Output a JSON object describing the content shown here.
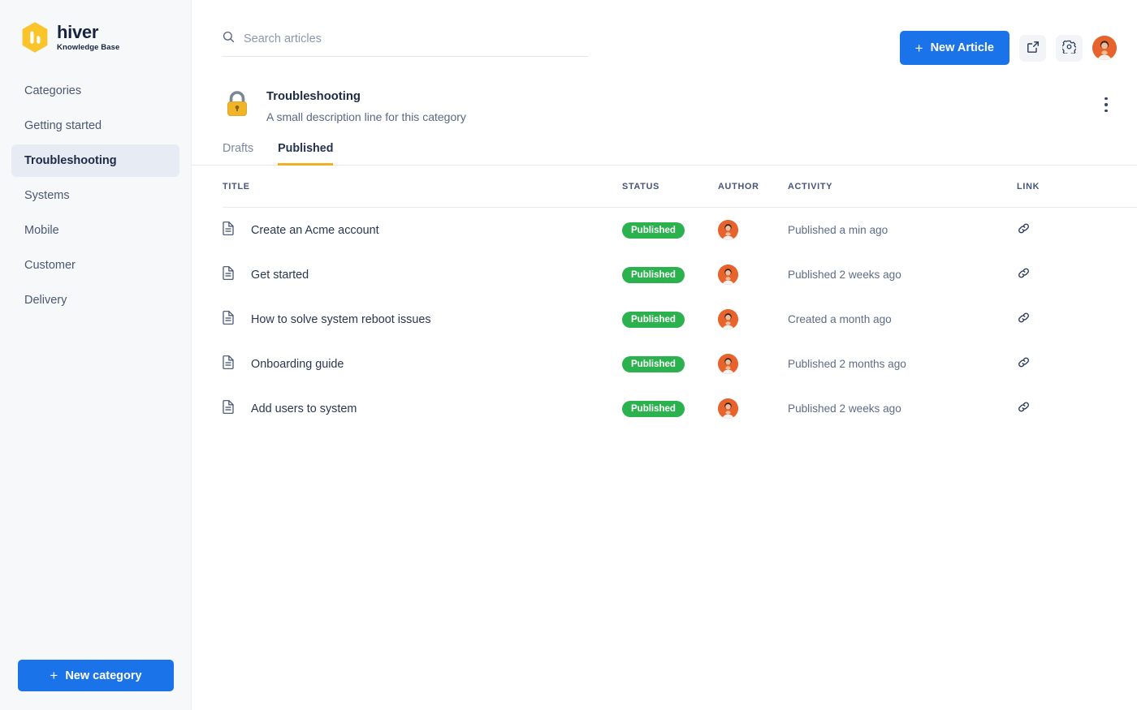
{
  "brand": {
    "name": "hiver",
    "subtitle": "Knowledge Base",
    "logo_icon": "hexagon-h-logo",
    "accent_yellow": "#fbc42b",
    "accent_blue": "#1a73e8"
  },
  "sidebar": {
    "items": [
      {
        "label": "Categories",
        "active": false
      },
      {
        "label": "Getting started",
        "active": false
      },
      {
        "label": "Troubleshooting",
        "active": true
      },
      {
        "label": "Systems",
        "active": false
      },
      {
        "label": "Mobile",
        "active": false
      },
      {
        "label": "Customer",
        "active": false
      },
      {
        "label": "Delivery",
        "active": false
      }
    ],
    "new_category_button": {
      "label": "New category",
      "icon": "plus-icon"
    }
  },
  "topbar": {
    "search": {
      "placeholder": "Search articles",
      "value": "",
      "icon": "search-icon"
    },
    "new_article_button": {
      "label": "New Article",
      "icon": "plus-icon"
    },
    "external_link_icon": "external-link-icon",
    "settings_icon": "gear-icon",
    "profile_avatar": "user-avatar"
  },
  "category": {
    "icon": "lock-icon",
    "title": "Troubleshooting",
    "description": "A small description line for this category",
    "menu_icon": "kebab-menu-icon"
  },
  "tabs": [
    {
      "label": "Drafts",
      "active": false
    },
    {
      "label": "Published",
      "active": true
    }
  ],
  "table": {
    "columns": [
      "TITLE",
      "STATUS",
      "AUTHOR",
      "ACTIVITY",
      "LINK"
    ],
    "rows": [
      {
        "icon": "document-icon",
        "title": "Create an Acme account",
        "status": "Published",
        "author": "user-avatar",
        "activity": "Published a min ago",
        "link": "link-icon"
      },
      {
        "icon": "document-icon",
        "title": "Get started",
        "status": "Published",
        "author": "user-avatar",
        "activity": "Published 2 weeks ago",
        "link": "link-icon"
      },
      {
        "icon": "document-icon",
        "title": "How to solve system reboot issues",
        "status": "Published",
        "author": "user-avatar",
        "activity": "Created a month ago",
        "link": "link-icon"
      },
      {
        "icon": "document-icon",
        "title": "Onboarding guide",
        "status": "Published",
        "author": "user-avatar",
        "activity": "Published 2 months ago",
        "link": "link-icon"
      },
      {
        "icon": "document-icon",
        "title": "Add users to system",
        "status": "Published",
        "author": "user-avatar",
        "activity": "Published 2 weeks ago",
        "link": "link-icon"
      }
    ]
  },
  "colors": {
    "status_published": "#2bb24e",
    "tab_underline": "#f4b024",
    "sidebar_active_bg": "#e7ebf4",
    "avatar_bg": "#e8622c"
  }
}
